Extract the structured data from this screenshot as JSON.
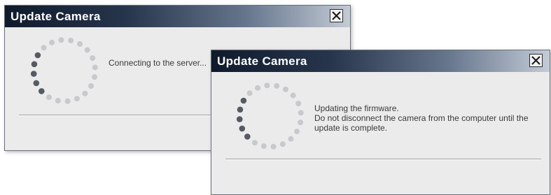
{
  "dialog_connecting": {
    "title": "Update Camera",
    "message": "Connecting to the server...",
    "close_icon": "close-x-icon",
    "spinner_icon": "progress-spinner-icon"
  },
  "dialog_updating": {
    "title": "Update Camera",
    "message_lines": [
      "Updating the firmware.",
      "Do not disconnect the camera from the computer until the",
      "update is complete."
    ],
    "close_icon": "close-x-icon",
    "spinner_icon": "progress-spinner-icon"
  },
  "colors": {
    "spinner_active": "#555a63",
    "spinner_inactive": "#c7c9cd",
    "dialog_body": "#ebebeb"
  }
}
